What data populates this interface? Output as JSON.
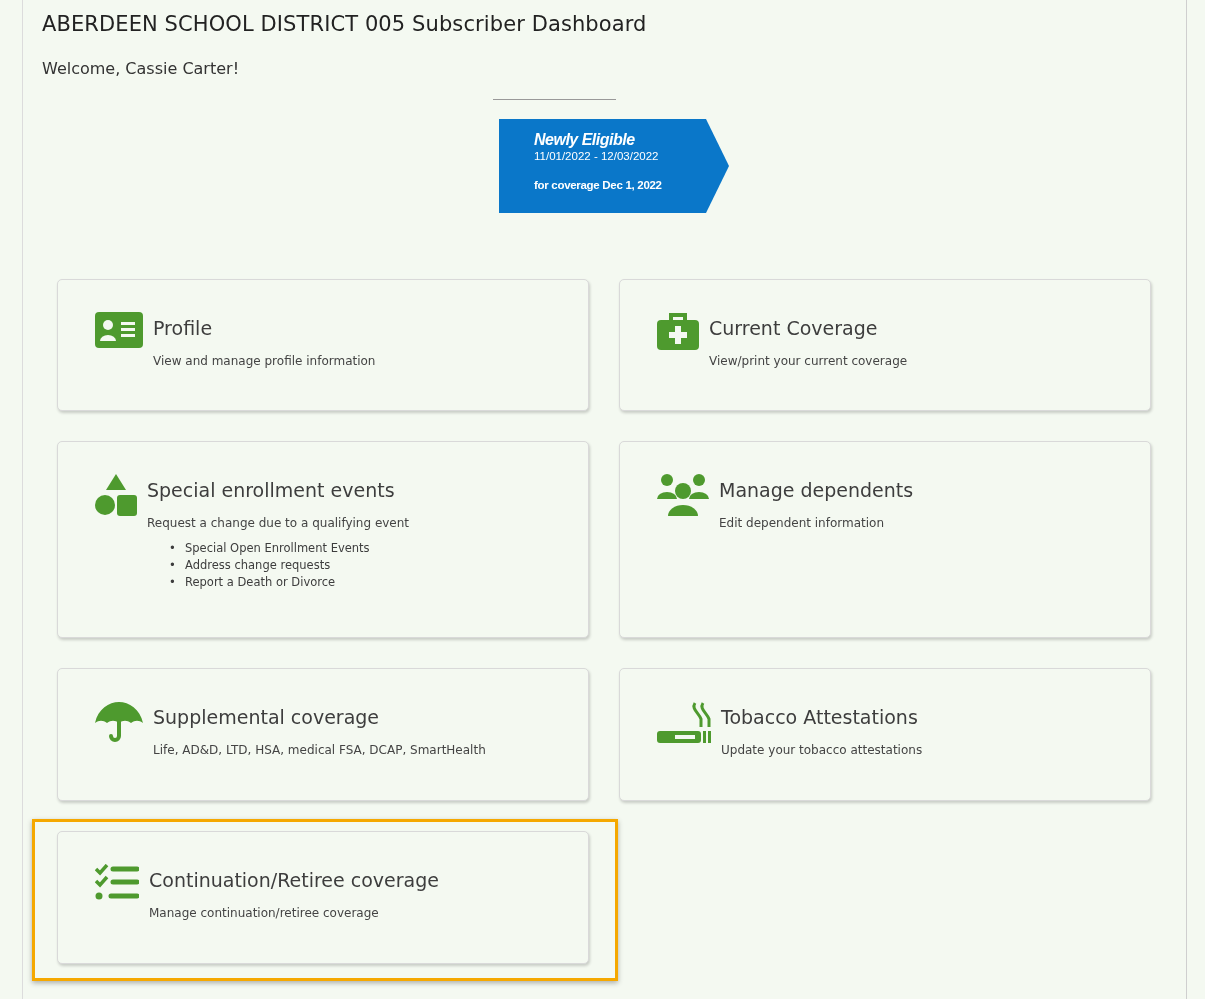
{
  "title": "ABERDEEN SCHOOL DISTRICT 005 Subscriber Dashboard",
  "welcome": "Welcome, Cassie Carter!",
  "banner": {
    "heading": "Newly Eligible",
    "dates": "11/01/2022 - 12/03/2022",
    "note": "for coverage Dec 1, 2022"
  },
  "cards": [
    {
      "kind": "id-card",
      "title": "Profile",
      "description": "View and manage profile information",
      "highlighted": false
    },
    {
      "kind": "medkit",
      "title": "Current Coverage",
      "description": "View/print your current coverage",
      "highlighted": false
    },
    {
      "kind": "shapes",
      "title": "Special enrollment events",
      "description": "Request a change due to a qualifying event",
      "bullets": [
        {
          "marker": "•",
          "text": "Special Open Enrollment Events"
        },
        {
          "marker": "•",
          "text": "Address change requests"
        },
        {
          "marker": "•",
          "text": "Report a Death or Divorce"
        }
      ],
      "highlighted": false
    },
    {
      "kind": "people",
      "title": "Manage dependents",
      "description": "Edit dependent information",
      "highlighted": false
    },
    {
      "kind": "umbrella",
      "title": "Supplemental coverage",
      "description": "Life, AD&D, LTD, HSA, medical FSA, DCAP, SmartHealth",
      "highlighted": false
    },
    {
      "kind": "smoking",
      "title": "Tobacco Attestations",
      "description": "Update your tobacco attestations",
      "highlighted": false
    },
    {
      "kind": "checklist",
      "title": "Continuation/Retiree coverage",
      "description": "Manage continuation/retiree coverage",
      "highlighted": true
    }
  ]
}
